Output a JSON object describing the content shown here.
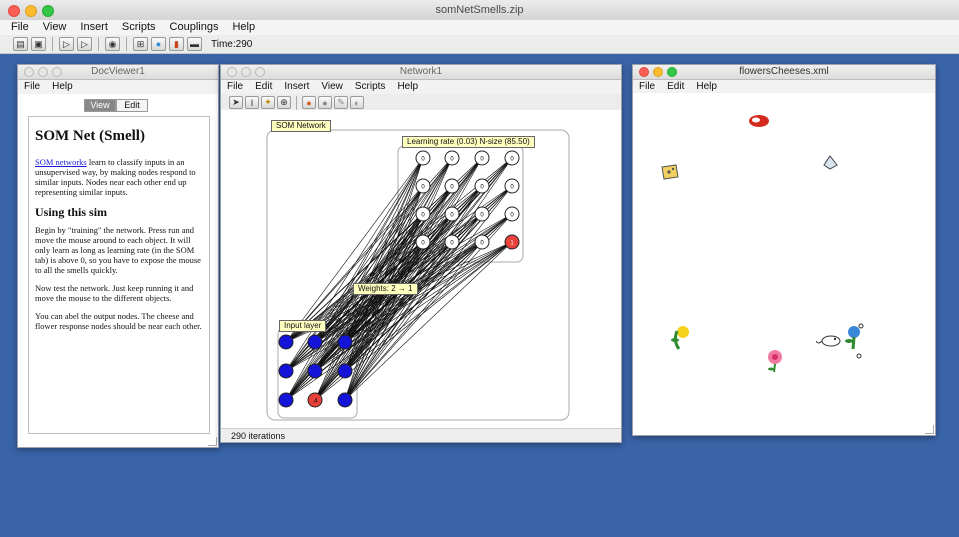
{
  "app": {
    "title": "somNetSmells.zip",
    "menu": [
      "File",
      "View",
      "Insert",
      "Scripts",
      "Couplings",
      "Help"
    ],
    "toolbar_icons": [
      "open-icon",
      "save-icon",
      "step-icon",
      "play-icon",
      "stop-icon",
      "network-icon",
      "world-icon",
      "globe-icon",
      "chart-icon",
      "image-icon"
    ],
    "time": "Time:290"
  },
  "doc": {
    "title": "DocViewer1",
    "menu": [
      "File",
      "Help"
    ],
    "tab_view": "View",
    "tab_edit": "Edit",
    "heading": "SOM Net (Smell)",
    "p1_link": "SOM networks",
    "p1_rest": " learn to classify inputs in an unsupervised way, by making nodes respond to similar inputs. Nodes near each other end up representing similar inputs.",
    "heading2": "Using this sim",
    "p2": "Begin by \"training\" the network. Press run and move the mouse around to each object. It will only learn as long as learning rate (in the SOM tab) is above 0, so you have to expose the mouse to all the smells quickly.",
    "p3": "Now test the network. Just keep running it and move the mouse to the different objects.",
    "p4": "You can abel the output nodes. The cheese and flower response nodes should be near each other."
  },
  "network": {
    "title": "Network1",
    "menu": [
      "File",
      "Edit",
      "Insert",
      "View",
      "Scripts",
      "Help"
    ],
    "som_label": "SOM Network",
    "lr_label": "Learning rate (0.03) N-size (85.50)",
    "weights_label": "Weights: 2 → 1",
    "input_label": "Input layer",
    "node_value": "0",
    "active_output_value": "1",
    "active_input_value": ".4",
    "status": "290 iterations",
    "active_color": "#e8413a",
    "input_color": "#1414d8"
  },
  "world": {
    "title": "flowersCheeses.xml",
    "menu": [
      "File",
      "Edit",
      "Help"
    ]
  }
}
